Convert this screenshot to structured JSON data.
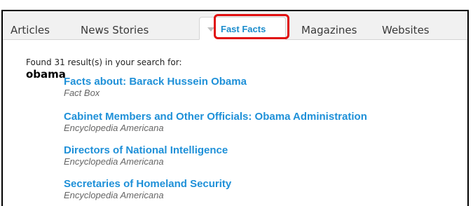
{
  "tabs": {
    "articles": "Articles",
    "news": "News Stories",
    "fast_facts": "Fast Facts",
    "magazines": "Magazines",
    "websites": "Websites"
  },
  "search": {
    "found_text": "Found 31 result(s) in your search for:",
    "query": "obama"
  },
  "results": [
    {
      "title": "Facts about: Barack Hussein Obama",
      "source": "Fact Box"
    },
    {
      "title": "Cabinet Members and Other Officials: Obama Administration",
      "source": "Encyclopedia Americana"
    },
    {
      "title": "Directors of National Intelligence",
      "source": "Encyclopedia Americana"
    },
    {
      "title": "Secretaries of Homeland Security",
      "source": "Encyclopedia Americana"
    }
  ],
  "colors": {
    "link": "#1e90d8",
    "active_tab_text": "#1a8ccc",
    "highlight": "#e01010"
  }
}
